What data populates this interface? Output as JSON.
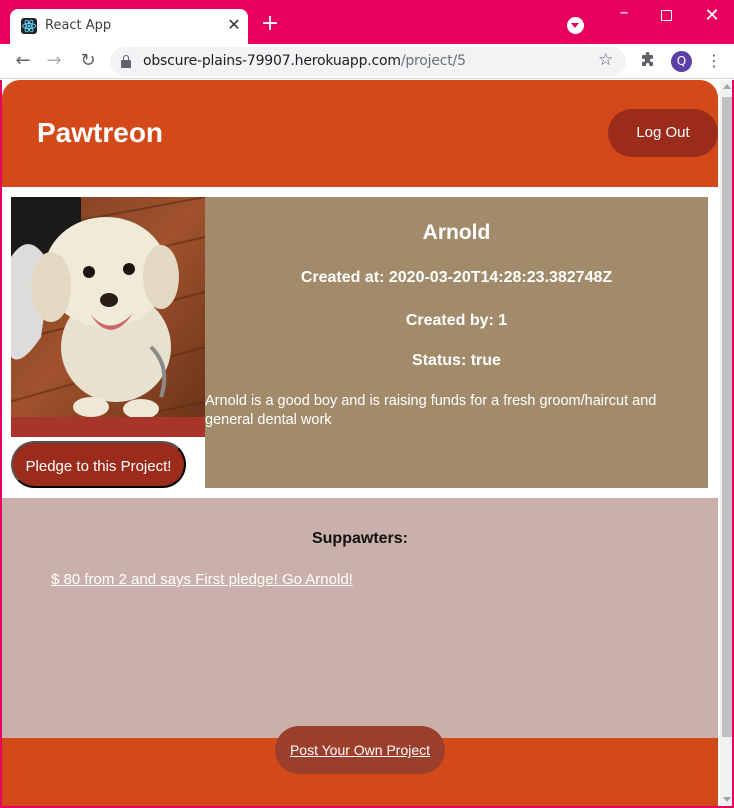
{
  "browser": {
    "tab_title": "React App",
    "tab_close_glyph": "✕",
    "new_tab_glyph": "+",
    "url_host": "obscure-plains-79907.herokuapp.com",
    "url_path": "/project/5",
    "profile_initial": "Q",
    "icons": {
      "favicon": "react-logo-icon",
      "back": "arrow-left-icon",
      "forward": "arrow-right-icon",
      "reload": "reload-icon",
      "lock": "lock-icon",
      "bookmark": "star-icon",
      "extensions": "puzzle-icon",
      "menu": "kebab-menu-icon"
    },
    "colors": {
      "titlebar": "#e8005f"
    }
  },
  "header": {
    "brand": "Pawtreon",
    "logout_label": "Log Out"
  },
  "project": {
    "name": "Arnold",
    "created_at": "Created at: 2020-03-20T14:28:23.382748Z",
    "created_by": "Created by: 1",
    "status": "Status: true",
    "description": "Arnold is a good boy and is raising funds for a fresh groom/haircut and general dental work",
    "pledge_label": "Pledge to this Project!",
    "image_alt": "white fluffy dog on wooden floor"
  },
  "supporters": {
    "title": "Suppawters:",
    "items": [
      {
        "text": "$ 80 from 2 and says First pledge! Go Arnold!"
      }
    ]
  },
  "footer": {
    "post_label": "Post Your Own Project"
  },
  "colors": {
    "header": "#d44919",
    "button": "#9b2c1c",
    "info_panel": "#a28b6b",
    "supporters_bg": "#c9b0aa"
  }
}
